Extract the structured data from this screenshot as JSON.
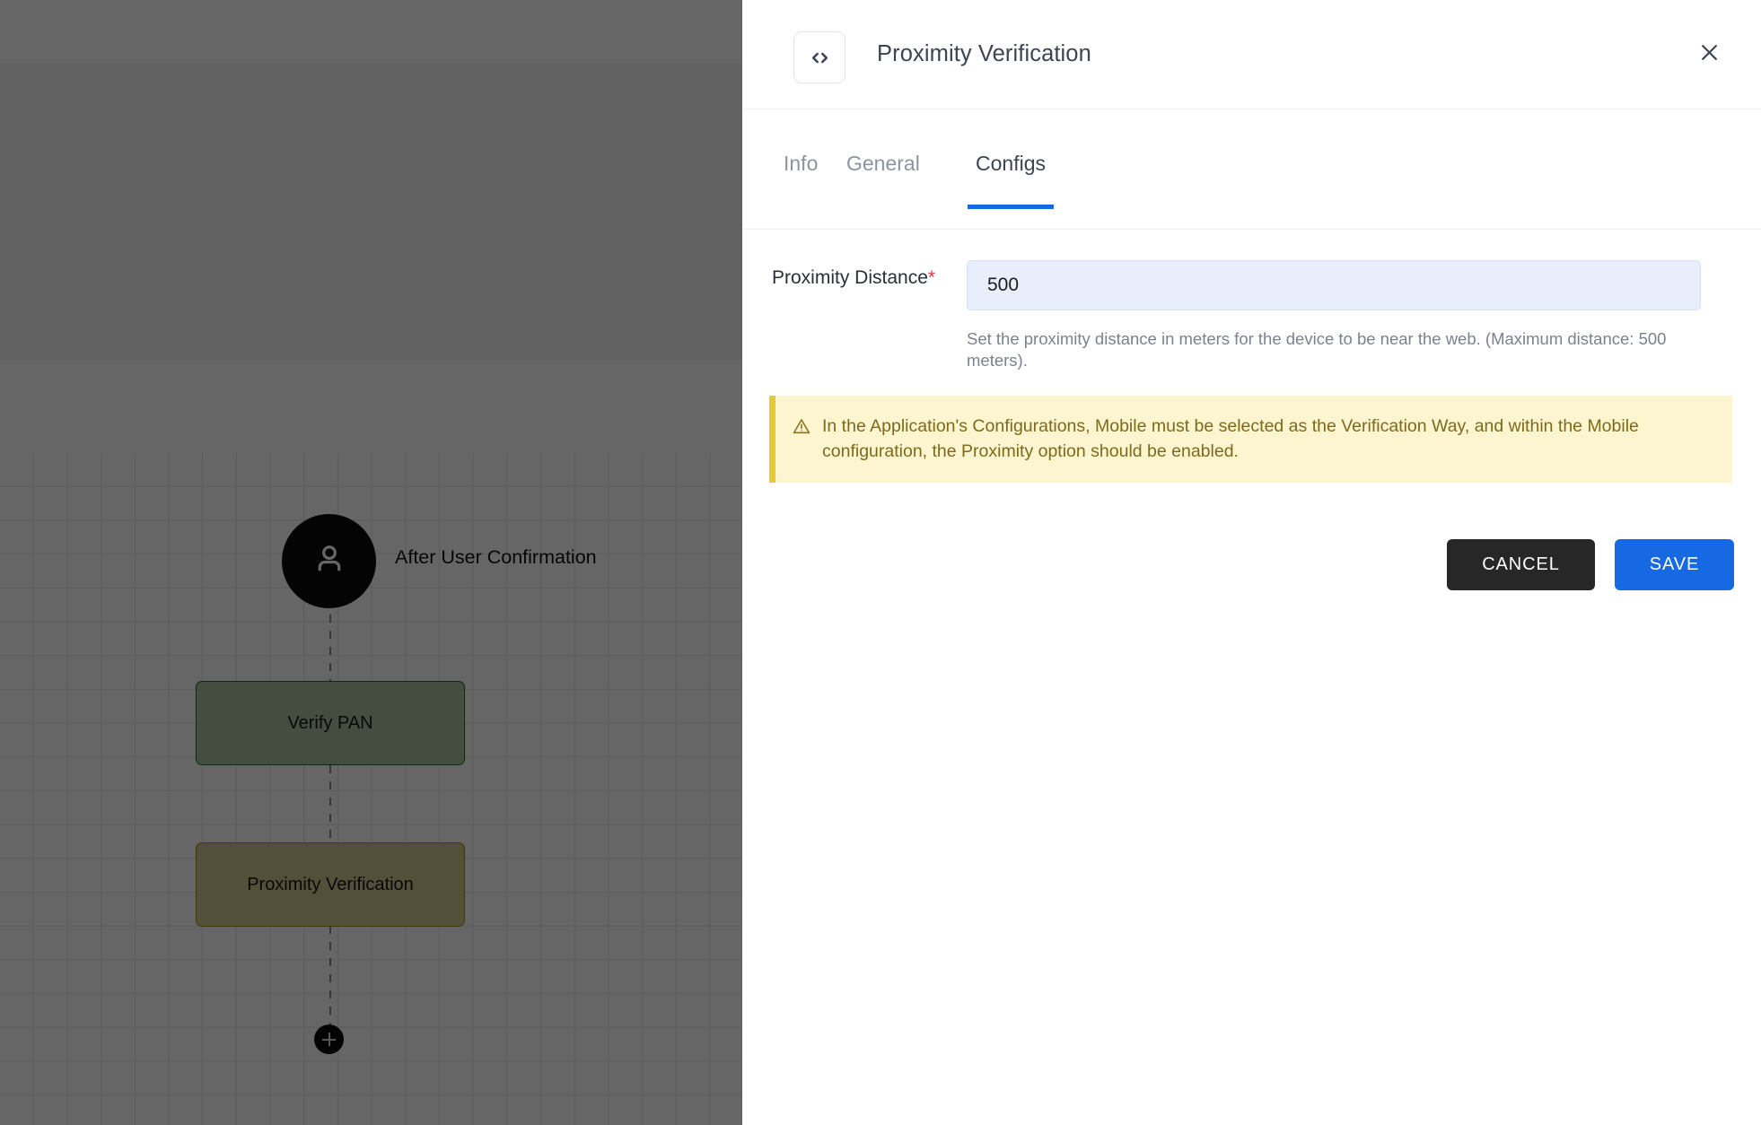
{
  "canvas": {
    "trigger": {
      "icon": "user-avatar-icon",
      "label": "After User Confirmation"
    },
    "nodes": [
      {
        "label": "Verify PAN",
        "fill": "#a8c3a4",
        "border": "#1f6b2e"
      },
      {
        "label": "Proximity Verification",
        "fill": "#cfc68d",
        "border": "#a08f16"
      }
    ],
    "add_button_icon": "plus-icon"
  },
  "panel": {
    "header": {
      "icon": "code-brackets-icon",
      "title": "Proximity Verification",
      "close_icon": "close-icon"
    },
    "tabs": [
      {
        "label": "Info",
        "active": false
      },
      {
        "label": "General",
        "active": false
      },
      {
        "label": "Configs",
        "active": true
      }
    ],
    "form": {
      "field_label": "Proximity Distance",
      "required_marker": "*",
      "input_value": "500",
      "input_placeholder": "",
      "help_text": "Set the proximity distance in meters for the device to be near the web. (Maximum distance: 500 meters)."
    },
    "warning": {
      "icon": "warning-triangle-icon",
      "text": "In the Application's Configurations, Mobile must be selected as the Verification Way, and within the Mobile configuration, the Proximity option should be enabled."
    },
    "actions": {
      "cancel_label": "CANCEL",
      "save_label": "SAVE"
    }
  },
  "colors": {
    "accent_blue": "#1668e3",
    "dark_button": "#272727",
    "warning_bg": "#fcf5cf",
    "warning_border": "#e5c93c",
    "input_bg": "#e8eefb",
    "required_red": "#d93a3a"
  }
}
